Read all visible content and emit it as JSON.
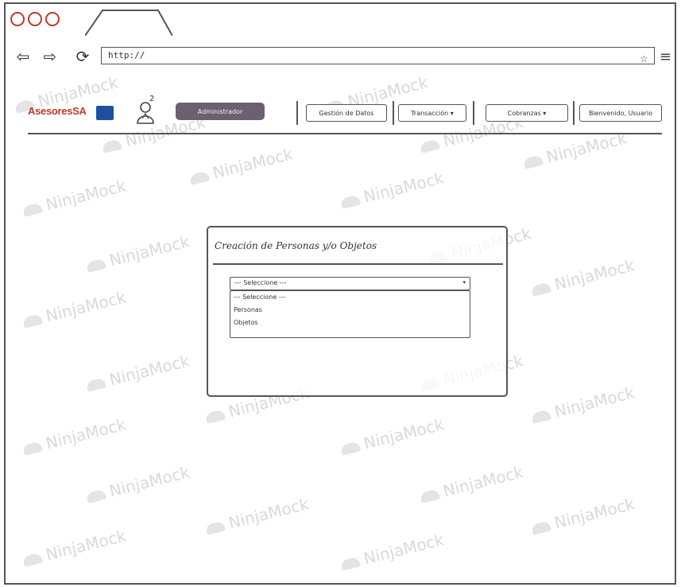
{
  "browser": {
    "url": "http://",
    "back_icon": "left-arrow-icon",
    "forward_icon": "right-arrow-icon",
    "reload_icon": "reload-icon",
    "bookmark_icon": "star-icon",
    "menu_icon": "hamburger-icon",
    "window_control_color": "#c0392b"
  },
  "header": {
    "logo_text": "AsesoresSA",
    "admin_button": "Administrador",
    "nav": {
      "data_mgmt": "Gestión de Datos",
      "transactions": "Transacción ▾",
      "collections": "Cobranzas ▾",
      "welcome": "Bienvenido, Usuario"
    }
  },
  "modal": {
    "title": "Creación de Personas y/o Objetos",
    "select_value": "--- Seleccione ---",
    "options": [
      "--- Seleccione ---",
      "Personas",
      "Objetos"
    ]
  },
  "watermark": {
    "text": "NinjaMock"
  },
  "colors": {
    "admin_button_bg": "#6b6070",
    "border": "#555555"
  }
}
